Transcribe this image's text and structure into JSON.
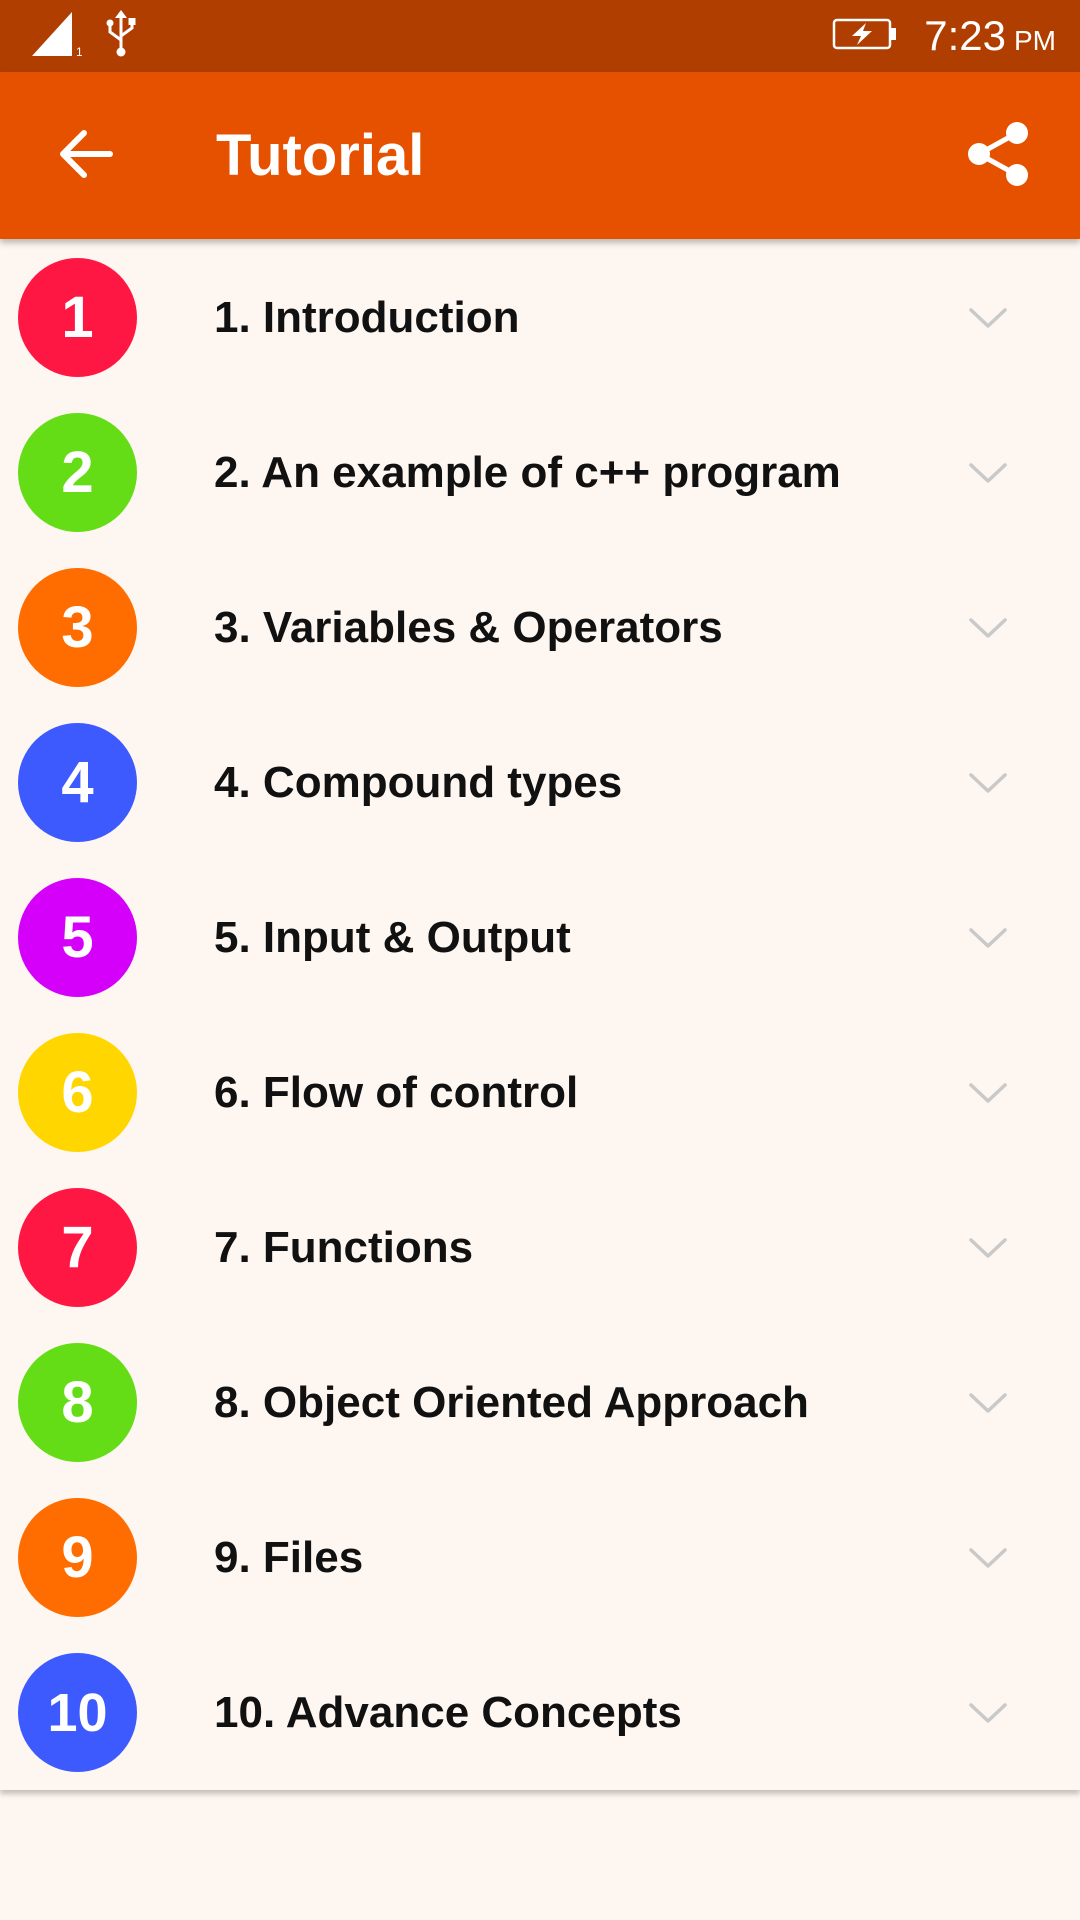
{
  "status_bar": {
    "time": "7:23",
    "ampm": "PM",
    "icons": [
      "signal-icon",
      "usb-icon",
      "battery-charging-icon"
    ],
    "signal_sim": "1"
  },
  "app_bar": {
    "title": "Tutorial",
    "back_icon": "arrow-left-icon",
    "share_icon": "share-icon",
    "color": "#e65100",
    "status_color": "#b03e00"
  },
  "list": {
    "items": [
      {
        "number": "1",
        "label": "1. Introduction",
        "color": "#ff1744"
      },
      {
        "number": "2",
        "label": "2. An example of c++ program",
        "color": "#64dd17"
      },
      {
        "number": "3",
        "label": "3. Variables & Operators",
        "color": "#ff6d00"
      },
      {
        "number": "4",
        "label": "4. Compound types",
        "color": "#3d5afe"
      },
      {
        "number": "5",
        "label": "5. Input & Output",
        "color": "#d500f9"
      },
      {
        "number": "6",
        "label": "6. Flow of control",
        "color": "#ffd600"
      },
      {
        "number": "7",
        "label": "7. Functions",
        "color": "#ff1744"
      },
      {
        "number": "8",
        "label": "8. Object Oriented Approach",
        "color": "#64dd17"
      },
      {
        "number": "9",
        "label": "9. Files",
        "color": "#ff6d00"
      },
      {
        "number": "10",
        "label": "10. Advance Concepts",
        "color": "#3d5afe"
      }
    ],
    "chevron_icon": "chevron-down-icon"
  }
}
